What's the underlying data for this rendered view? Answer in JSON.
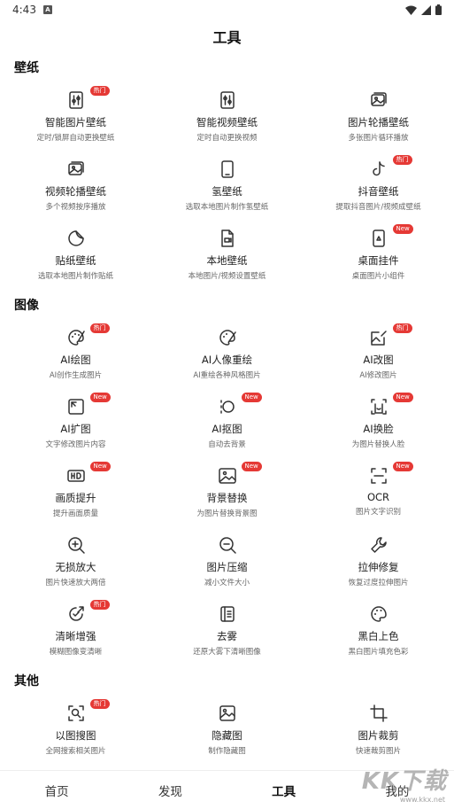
{
  "status_bar": {
    "time": "4:43",
    "app_icon_letter": "A"
  },
  "header": {
    "title": "工具"
  },
  "sections": [
    {
      "title": "壁纸",
      "items": [
        {
          "name": "智能图片壁纸",
          "desc": "定时/锁屏自动更换壁纸",
          "icon": "smart-image-wallpaper-icon",
          "badge": "热门"
        },
        {
          "name": "智能视频壁纸",
          "desc": "定时自动更换视频",
          "icon": "smart-video-wallpaper-icon",
          "badge": ""
        },
        {
          "name": "图片轮播壁纸",
          "desc": "多张图片循环播放",
          "icon": "image-carousel-icon",
          "badge": ""
        },
        {
          "name": "视频轮播壁纸",
          "desc": "多个视频按序播放",
          "icon": "video-carousel-icon",
          "badge": ""
        },
        {
          "name": "氢壁纸",
          "desc": "选取本地图片制作氢壁纸",
          "icon": "phone-frame-icon",
          "badge": ""
        },
        {
          "name": "抖音壁纸",
          "desc": "提取抖音图片/视频成壁纸",
          "icon": "tiktok-icon",
          "badge": "热门"
        },
        {
          "name": "贴纸壁纸",
          "desc": "选取本地图片制作贴纸",
          "icon": "sticker-icon",
          "badge": ""
        },
        {
          "name": "本地壁纸",
          "desc": "本地图片/视频设置壁纸",
          "icon": "local-file-icon",
          "badge": ""
        },
        {
          "name": "桌面挂件",
          "desc": "桌面图片小组件",
          "icon": "widget-icon",
          "badge": "New"
        }
      ]
    },
    {
      "title": "图像",
      "items": [
        {
          "name": "AI绘图",
          "desc": "AI创作生成图片",
          "icon": "palette-icon",
          "badge": "热门"
        },
        {
          "name": "AI人像重绘",
          "desc": "AI重绘各种风格图片",
          "icon": "palette-brush-icon",
          "badge": ""
        },
        {
          "name": "AI改图",
          "desc": "AI修改图片",
          "icon": "image-edit-icon",
          "badge": "热门"
        },
        {
          "name": "AI扩图",
          "desc": "文字修改图片内容",
          "icon": "ai-expand-icon",
          "badge": "New"
        },
        {
          "name": "AI抠图",
          "desc": "自动去背景",
          "icon": "cutout-icon",
          "badge": "New"
        },
        {
          "name": "AI换脸",
          "desc": "为图片替换人脸",
          "icon": "face-swap-icon",
          "badge": "New"
        },
        {
          "name": "画质提升",
          "desc": "提升画面质量",
          "icon": "hd-icon",
          "badge": "New"
        },
        {
          "name": "背景替换",
          "desc": "为图片替换背景图",
          "icon": "landscape-image-icon",
          "badge": "New"
        },
        {
          "name": "OCR",
          "desc": "图片文字识别",
          "icon": "ocr-icon",
          "badge": "New"
        },
        {
          "name": "无损放大",
          "desc": "图片快速放大两倍",
          "icon": "zoom-in-icon",
          "badge": ""
        },
        {
          "name": "图片压缩",
          "desc": "减小文件大小",
          "icon": "zoom-out-icon",
          "badge": ""
        },
        {
          "name": "拉伸修复",
          "desc": "恢复过度拉伸图片",
          "icon": "wrench-icon",
          "badge": ""
        },
        {
          "name": "清晰增强",
          "desc": "模糊图像变清晰",
          "icon": "enhance-icon",
          "badge": "热门"
        },
        {
          "name": "去雾",
          "desc": "还原大雾下清晰图像",
          "icon": "dehaze-icon",
          "badge": ""
        },
        {
          "name": "黑白上色",
          "desc": "黑白图片填充色彩",
          "icon": "colorize-palette-icon",
          "badge": ""
        }
      ]
    },
    {
      "title": "其他",
      "items": [
        {
          "name": "以图搜图",
          "desc": "全网搜索相关图片",
          "icon": "image-search-icon",
          "badge": "热门"
        },
        {
          "name": "隐藏图",
          "desc": "制作隐藏图",
          "icon": "hidden-image-icon",
          "badge": ""
        },
        {
          "name": "图片裁剪",
          "desc": "快速裁剪图片",
          "icon": "crop-icon",
          "badge": ""
        }
      ]
    }
  ],
  "bottom_nav": [
    {
      "label": "首页",
      "active": false
    },
    {
      "label": "发现",
      "active": false
    },
    {
      "label": "工具",
      "active": true
    },
    {
      "label": "我的",
      "active": false
    }
  ],
  "watermark": {
    "text": "KK下载",
    "url": "www.kkx.net"
  },
  "colors": {
    "badge": "#e53935",
    "text": "#222222",
    "desc": "#666666"
  }
}
